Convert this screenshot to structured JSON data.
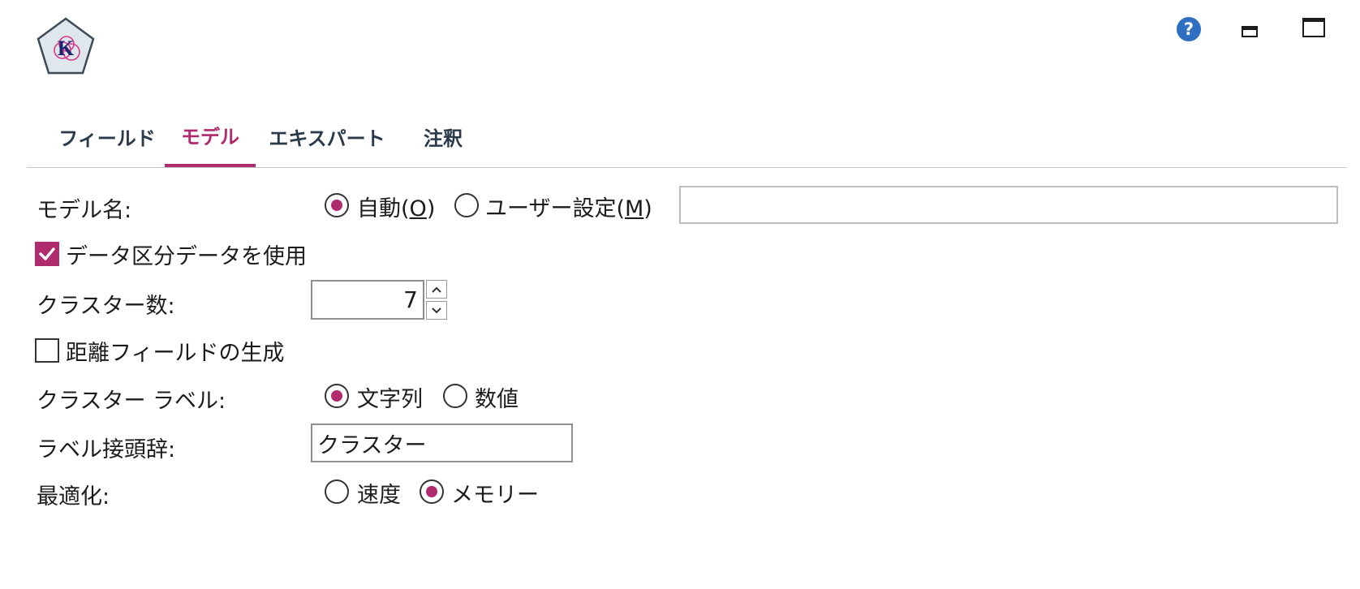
{
  "tabs": [
    {
      "label": "フィールド"
    },
    {
      "label": "モデル"
    },
    {
      "label": "エキスパート"
    },
    {
      "label": "注釈"
    }
  ],
  "active_tab": "モデル",
  "model_name": {
    "label": "モデル名:",
    "auto_label": "自動(",
    "auto_key": "O",
    "auto_close": ")",
    "custom_label": "ユーザー設定(",
    "custom_key": "M",
    "custom_close": ")",
    "selected": "auto",
    "custom_value": ""
  },
  "use_partition": {
    "label": "データ区分データを使用",
    "checked": true
  },
  "cluster_count": {
    "label": "クラスター数:",
    "value": "7"
  },
  "distance_field": {
    "label": "距離フィールドの生成",
    "checked": false
  },
  "cluster_label": {
    "label": "クラスター ラベル:",
    "string_label": "文字列",
    "number_label": "数値",
    "selected": "string"
  },
  "label_prefix": {
    "label": "ラベル接頭辞:",
    "value": "クラスター"
  },
  "optimize": {
    "label": "最適化:",
    "speed_label": "速度",
    "memory_label": "メモリー",
    "selected": "memory"
  },
  "colors": {
    "accent": "#b02a6e",
    "tab_text": "#2b3a4a",
    "help_blue": "#2f6fc2"
  },
  "icons": {
    "logo": "kmeans-node-icon",
    "help": "help-icon",
    "minimize": "minimize-icon",
    "maximize": "maximize-icon"
  }
}
